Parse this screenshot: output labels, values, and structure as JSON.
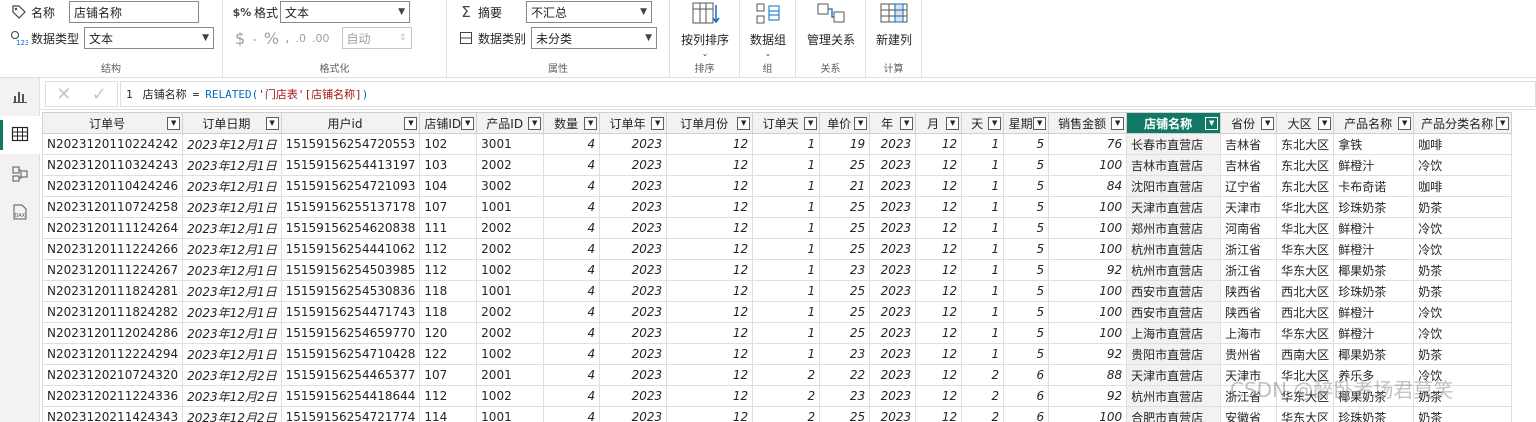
{
  "ribbon": {
    "structure": {
      "name_label": "名称",
      "name_value": "店铺名称",
      "datatype_label": "数据类型",
      "datatype_value": "文本",
      "group_label": "结构"
    },
    "formatting": {
      "format_label": "格式",
      "format_value": "文本",
      "auto_value": "自动",
      "group_label": "格式化"
    },
    "properties": {
      "summary_label": "摘要",
      "summary_value": "不汇总",
      "category_label": "数据类别",
      "category_value": "未分类",
      "group_label": "属性"
    },
    "sort": {
      "button_label": "按列排序",
      "group_label": "排序"
    },
    "groups": {
      "button_label": "数据组",
      "group_label": "组"
    },
    "relations": {
      "button_label": "管理关系",
      "group_label": "关系"
    },
    "calc": {
      "button_label": "新建列",
      "group_label": "计算"
    }
  },
  "formula": {
    "line_number": "1",
    "column_name": "店铺名称",
    "operator": "=",
    "function": "RELATED(",
    "argument": "'门店表'[店铺名称]",
    "close": ")"
  },
  "table": {
    "headers": [
      "订单号",
      "订单日期",
      "用户id",
      "店铺ID",
      "产品ID",
      "数量",
      "订单年",
      "订单月份",
      "订单天",
      "单价",
      "年",
      "月",
      "天",
      "星期",
      "销售金额",
      "店铺名称",
      "省份",
      "大区",
      "产品名称",
      "产品分类名称"
    ],
    "selected_column": 15,
    "rows": [
      [
        "N2023120110224242",
        "2023年12月1日",
        "15159156254720553",
        "102",
        "3001",
        "4",
        "2023",
        "12",
        "1",
        "19",
        "2023",
        "12",
        "1",
        "5",
        "76",
        "长春市直营店",
        "吉林省",
        "东北大区",
        "拿铁",
        "咖啡"
      ],
      [
        "N2023120110324243",
        "2023年12月1日",
        "15159156254413197",
        "103",
        "2002",
        "4",
        "2023",
        "12",
        "1",
        "25",
        "2023",
        "12",
        "1",
        "5",
        "100",
        "吉林市直营店",
        "吉林省",
        "东北大区",
        "鲜橙汁",
        "冷饮"
      ],
      [
        "N2023120110424246",
        "2023年12月1日",
        "15159156254721093",
        "104",
        "3002",
        "4",
        "2023",
        "12",
        "1",
        "21",
        "2023",
        "12",
        "1",
        "5",
        "84",
        "沈阳市直营店",
        "辽宁省",
        "东北大区",
        "卡布奇诺",
        "咖啡"
      ],
      [
        "N2023120110724258",
        "2023年12月1日",
        "15159156255137178",
        "107",
        "1001",
        "4",
        "2023",
        "12",
        "1",
        "25",
        "2023",
        "12",
        "1",
        "5",
        "100",
        "天津市直营店",
        "天津市",
        "华北大区",
        "珍珠奶茶",
        "奶茶"
      ],
      [
        "N2023120111124264",
        "2023年12月1日",
        "15159156254620838",
        "111",
        "2002",
        "4",
        "2023",
        "12",
        "1",
        "25",
        "2023",
        "12",
        "1",
        "5",
        "100",
        "郑州市直营店",
        "河南省",
        "华北大区",
        "鲜橙汁",
        "冷饮"
      ],
      [
        "N2023120111224266",
        "2023年12月1日",
        "15159156254441062",
        "112",
        "2002",
        "4",
        "2023",
        "12",
        "1",
        "25",
        "2023",
        "12",
        "1",
        "5",
        "100",
        "杭州市直营店",
        "浙江省",
        "华东大区",
        "鲜橙汁",
        "冷饮"
      ],
      [
        "N2023120111224267",
        "2023年12月1日",
        "15159156254503985",
        "112",
        "1002",
        "4",
        "2023",
        "12",
        "1",
        "23",
        "2023",
        "12",
        "1",
        "5",
        "92",
        "杭州市直营店",
        "浙江省",
        "华东大区",
        "椰果奶茶",
        "奶茶"
      ],
      [
        "N2023120111824281",
        "2023年12月1日",
        "15159156254530836",
        "118",
        "1001",
        "4",
        "2023",
        "12",
        "1",
        "25",
        "2023",
        "12",
        "1",
        "5",
        "100",
        "西安市直营店",
        "陕西省",
        "西北大区",
        "珍珠奶茶",
        "奶茶"
      ],
      [
        "N2023120111824282",
        "2023年12月1日",
        "15159156254471743",
        "118",
        "2002",
        "4",
        "2023",
        "12",
        "1",
        "25",
        "2023",
        "12",
        "1",
        "5",
        "100",
        "西安市直营店",
        "陕西省",
        "西北大区",
        "鲜橙汁",
        "冷饮"
      ],
      [
        "N2023120112024286",
        "2023年12月1日",
        "15159156254659770",
        "120",
        "2002",
        "4",
        "2023",
        "12",
        "1",
        "25",
        "2023",
        "12",
        "1",
        "5",
        "100",
        "上海市直营店",
        "上海市",
        "华东大区",
        "鲜橙汁",
        "冷饮"
      ],
      [
        "N2023120112224294",
        "2023年12月1日",
        "15159156254710428",
        "122",
        "1002",
        "4",
        "2023",
        "12",
        "1",
        "23",
        "2023",
        "12",
        "1",
        "5",
        "92",
        "贵阳市直营店",
        "贵州省",
        "西南大区",
        "椰果奶茶",
        "奶茶"
      ],
      [
        "N2023120210724320",
        "2023年12月2日",
        "15159156254465377",
        "107",
        "2001",
        "4",
        "2023",
        "12",
        "2",
        "22",
        "2023",
        "12",
        "2",
        "6",
        "88",
        "天津市直营店",
        "天津市",
        "华北大区",
        "养乐多",
        "冷饮"
      ],
      [
        "N2023120211224336",
        "2023年12月2日",
        "15159156254418644",
        "112",
        "1002",
        "4",
        "2023",
        "12",
        "2",
        "23",
        "2023",
        "12",
        "2",
        "6",
        "92",
        "杭州市直营店",
        "浙江省",
        "华东大区",
        "椰果奶茶",
        "奶茶"
      ],
      [
        "N2023120211424343",
        "2023年12月2日",
        "15159156254721774",
        "114",
        "1001",
        "4",
        "2023",
        "12",
        "2",
        "25",
        "2023",
        "12",
        "2",
        "6",
        "100",
        "合肥市直营店",
        "安徽省",
        "华东大区",
        "珍珠奶茶",
        "奶茶"
      ]
    ]
  },
  "watermark": "CSDN @醉卧考场君莫笑",
  "colors": {
    "accent": "#117865",
    "function": "#0b6bcb",
    "string": "#a31515"
  }
}
